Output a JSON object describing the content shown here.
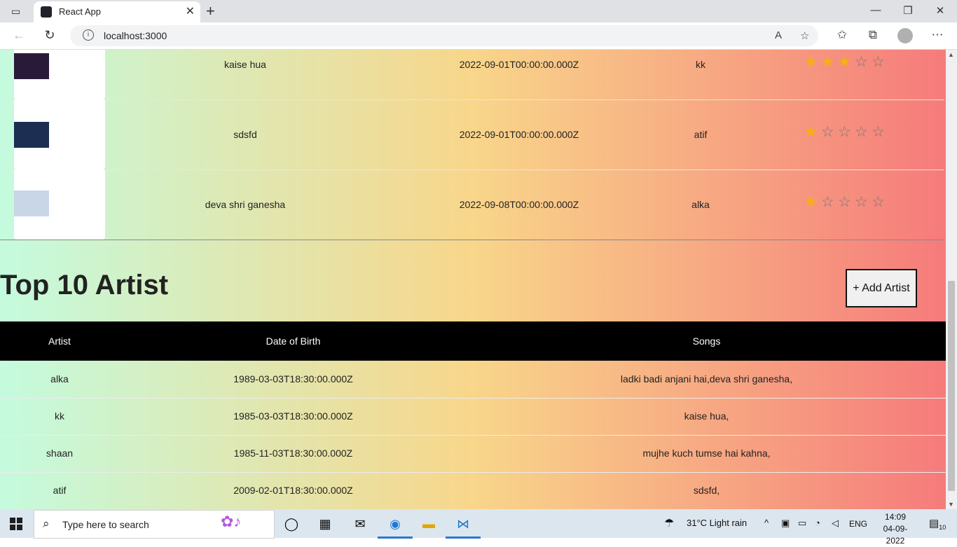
{
  "browser": {
    "tab_title": "React App",
    "url": "localhost:3000"
  },
  "songs": [
    {
      "name": "kaise hua",
      "date": "2022-09-01T00:00:00.000Z",
      "artist": "kk",
      "rating": 3,
      "thumb_color": "#2a1a3a"
    },
    {
      "name": "sdsfd",
      "date": "2022-09-01T00:00:00.000Z",
      "artist": "atif",
      "rating": 1,
      "thumb_color": "#1c2e52"
    },
    {
      "name": "deva shri ganesha",
      "date": "2022-09-08T00:00:00.000Z",
      "artist": "alka",
      "rating": 1,
      "thumb_color": "#c9d6e8"
    }
  ],
  "artists_section": {
    "heading": "Top 10 Artist",
    "add_button": "+ Add Artist",
    "columns": [
      "Artist",
      "Date of Birth",
      "Songs"
    ],
    "rows": [
      {
        "artist": "alka",
        "dob": "1989-03-03T18:30:00.000Z",
        "songs": "ladki badi anjani hai,deva shri ganesha,"
      },
      {
        "artist": "kk",
        "dob": "1985-03-03T18:30:00.000Z",
        "songs": "kaise hua,"
      },
      {
        "artist": "shaan",
        "dob": "1985-11-03T18:30:00.000Z",
        "songs": "mujhe kuch tumse hai kahna,"
      },
      {
        "artist": "atif",
        "dob": "2009-02-01T18:30:00.000Z",
        "songs": "sdsfd,"
      }
    ]
  },
  "colors": {
    "gradient_start": "#c4fbde",
    "gradient_mid": "#f8d68a",
    "gradient_end": "#f67b7b",
    "star_on": "#f4b20c",
    "table_header_bg": "#000000"
  },
  "taskbar": {
    "search_placeholder": "Type here to search",
    "weather": "31°C  Light rain",
    "language": "ENG",
    "time": "14:09",
    "date": "04-09-2022",
    "notification_count": "10"
  }
}
